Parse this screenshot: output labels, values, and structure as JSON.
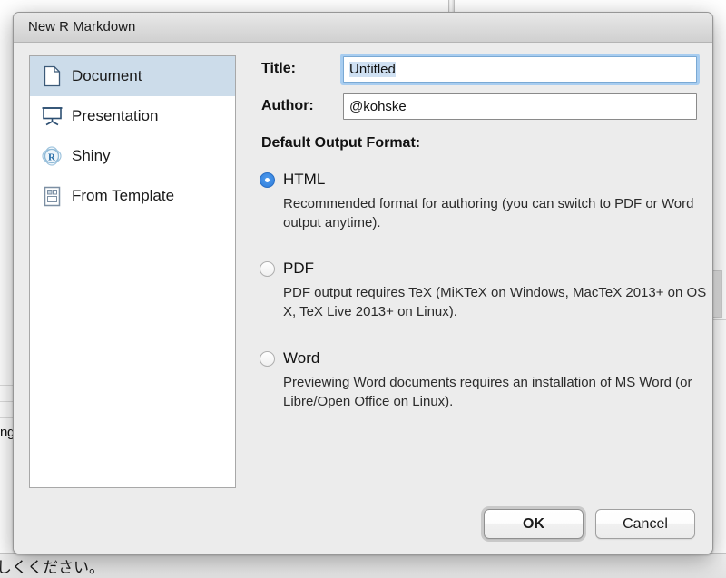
{
  "background": {
    "text_fragment": "ng",
    "bottom_text": "しくください。"
  },
  "dialog": {
    "title": "New R Markdown",
    "document_types": [
      {
        "label": "Document",
        "icon": "document-icon",
        "selected": true
      },
      {
        "label": "Presentation",
        "icon": "presentation-icon",
        "selected": false
      },
      {
        "label": "Shiny",
        "icon": "shiny-r-icon",
        "selected": false
      },
      {
        "label": "From Template",
        "icon": "template-icon",
        "selected": false
      }
    ],
    "fields": {
      "title": {
        "label": "Title:",
        "value": "Untitled",
        "placeholder": "Untitled",
        "focused": true
      },
      "author": {
        "label": "Author:",
        "value": "@kohske",
        "placeholder": "Author",
        "focused": false
      }
    },
    "output_format": {
      "section_label": "Default Output Format:",
      "selected": "HTML",
      "options": [
        {
          "name": "HTML",
          "selected": true,
          "description": "Recommended format for authoring (you can switch to PDF or Word output anytime)."
        },
        {
          "name": "PDF",
          "selected": false,
          "description": "PDF output requires TeX (MiKTeX on Windows, MacTeX 2013+ on OS X, TeX Live 2013+ on Linux)."
        },
        {
          "name": "Word",
          "selected": false,
          "description": "Previewing Word documents requires an installation of MS Word (or Libre/Open Office on Linux)."
        }
      ]
    },
    "buttons": {
      "ok": "OK",
      "cancel": "Cancel"
    }
  },
  "colors": {
    "selection_blue": "#ccdcea",
    "radio_blue": "#2f7ddc",
    "focus_ring": "#a8cdf0",
    "dialog_bg": "#ececec"
  }
}
